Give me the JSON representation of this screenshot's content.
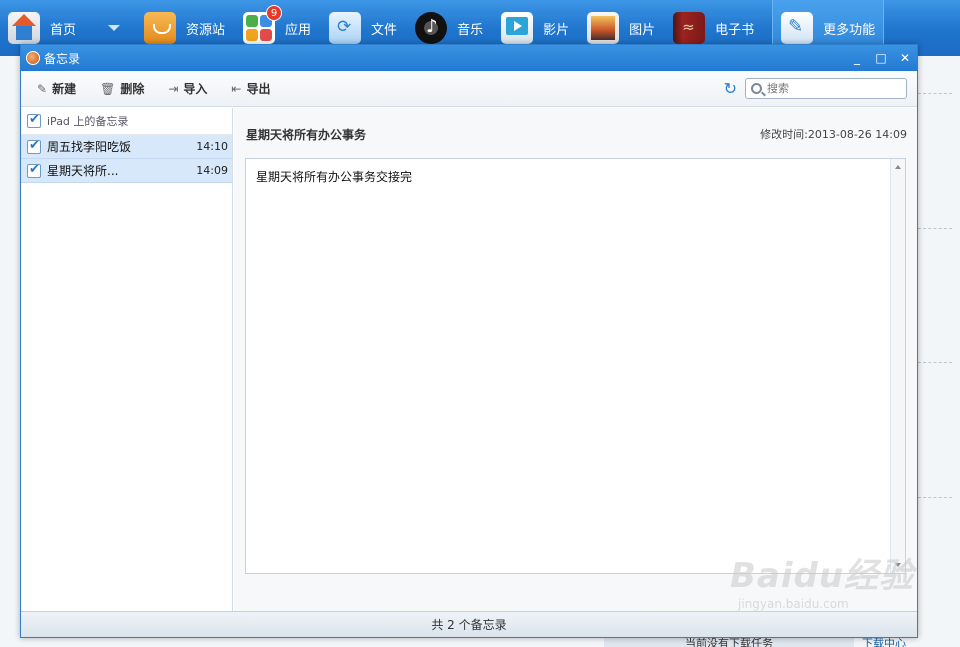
{
  "topnav": {
    "items": [
      {
        "label": "首页",
        "icon": "home-icon"
      },
      {
        "label": "资源站",
        "icon": "shopping-bag-icon"
      },
      {
        "label": "应用",
        "icon": "apps-icon",
        "badge": "9"
      },
      {
        "label": "文件",
        "icon": "file-sync-icon"
      },
      {
        "label": "音乐",
        "icon": "music-icon"
      },
      {
        "label": "影片",
        "icon": "video-play-icon"
      },
      {
        "label": "图片",
        "icon": "photo-icon"
      },
      {
        "label": "电子书",
        "icon": "ebook-icon"
      },
      {
        "label": "更多功能",
        "icon": "tools-icon"
      }
    ],
    "active": "更多功能"
  },
  "window": {
    "title": "备忘录",
    "buttons": {
      "minimize": "_",
      "maximize": "□",
      "close": "✕"
    }
  },
  "toolbar": {
    "new_label": "新建",
    "delete_label": "删除",
    "import_label": "导入",
    "export_label": "导出"
  },
  "search": {
    "placeholder": "搜索"
  },
  "sidebar": {
    "group_label": "iPad 上的备忘录",
    "memos": [
      {
        "title": "周五找李阳吃饭",
        "time": "14:10"
      },
      {
        "title": "星期天将所...",
        "time": "14:09"
      }
    ]
  },
  "note": {
    "title": "星期天将所有办公事务",
    "modified_label": "修改时间:",
    "modified_value": "2013-08-26 14:09",
    "body": "星期天将所有办公事务交接完"
  },
  "status": {
    "summary": "共 2 个备忘录"
  },
  "background": {
    "status_text": "当前没有下载任务",
    "download_center": "下载中心"
  },
  "watermark": {
    "main": "Baidu经验",
    "sub": "jingyan.baidu.com"
  },
  "colors": {
    "topbar": "#1f74cc",
    "selection": "#d7e8fb",
    "accent": "#2c7ed1"
  }
}
